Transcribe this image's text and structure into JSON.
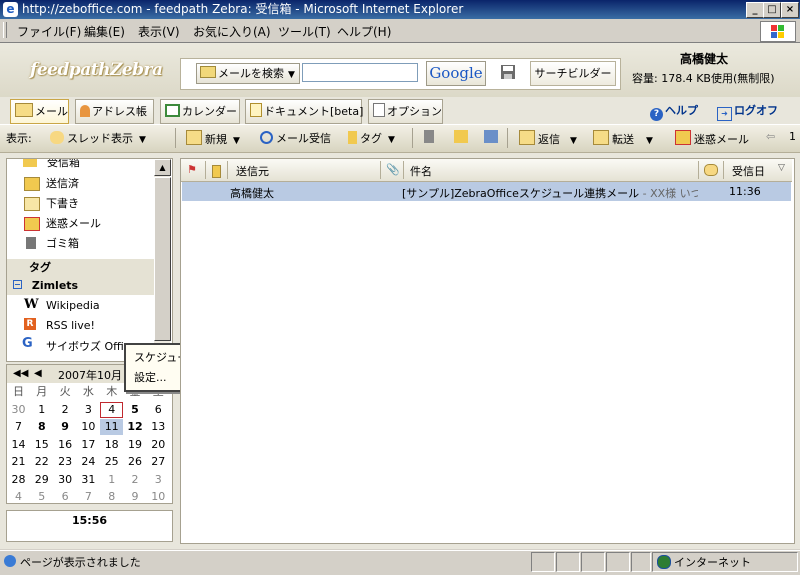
{
  "window": {
    "title": "http://zeboffice.com - feedpath Zebra: 受信箱 - Microsoft Internet Explorer",
    "minimize": "_",
    "maximize": "□",
    "close": "×"
  },
  "menubar": [
    "ファイル(F)",
    "編集(E)",
    "表示(V)",
    "お気に入り(A)",
    "ツール(T)",
    "ヘルプ(H)"
  ],
  "header": {
    "logo": "feedpathZebra",
    "search_type": "メールを検索",
    "search_value": "",
    "google_button": "Google",
    "search_builder": "サーチビルダー",
    "username": "高橋健太",
    "quota": "容量: 178.4 KB使用(無制限)"
  },
  "apptabs": {
    "mail": "メール",
    "addressbook": "アドレス帳",
    "calendar": "カレンダー",
    "documents": "ドキュメント[beta]",
    "options": "オプション",
    "help": "ヘルプ",
    "logoff": "ログオフ"
  },
  "toolbar": {
    "view_label": "表示:",
    "thread_view": "スレッド表示",
    "new": "新規",
    "receive": "メール受信",
    "tag": "タグ",
    "reply": "返信",
    "forward": "転送",
    "spam": "迷惑メール",
    "page_num": "1"
  },
  "folders": {
    "inbox": "受信箱",
    "sent": "送信済",
    "drafts": "下書き",
    "junk": "迷惑メール",
    "trash": "ゴミ箱"
  },
  "tags_header": "タグ",
  "zimlets": {
    "header": "Zimlets",
    "items": [
      "Wikipedia",
      "RSS live!",
      "サイボウズ Office"
    ]
  },
  "context_menu": [
    "スケジュールの同期",
    "設定..."
  ],
  "calendar": {
    "month_label": "2007年10月",
    "dow": [
      "日",
      "月",
      "火",
      "水",
      "木",
      "金",
      "土"
    ],
    "weeks": [
      [
        "30",
        "1",
        "2",
        "3",
        "4",
        "5",
        "6"
      ],
      [
        "7",
        "8",
        "9",
        "10",
        "11",
        "12",
        "13"
      ],
      [
        "14",
        "15",
        "16",
        "17",
        "18",
        "19",
        "20"
      ],
      [
        "21",
        "22",
        "23",
        "24",
        "25",
        "26",
        "27"
      ],
      [
        "28",
        "29",
        "30",
        "31",
        "1",
        "2",
        "3"
      ],
      [
        "4",
        "5",
        "6",
        "7",
        "8",
        "9",
        "10"
      ]
    ]
  },
  "clock": "15:56",
  "message_list": {
    "columns": {
      "from": "送信元",
      "subject": "件名",
      "received": "受信日"
    },
    "rows": [
      {
        "from": "高橋健太",
        "subject": "[サンプル]ZebraOfficeスケジュール連携メール",
        "fragment": " - XX様 いつもお世",
        "date": "11:36"
      }
    ]
  },
  "statusbar": {
    "text": "ページが表示されました",
    "zone": "インターネット"
  }
}
